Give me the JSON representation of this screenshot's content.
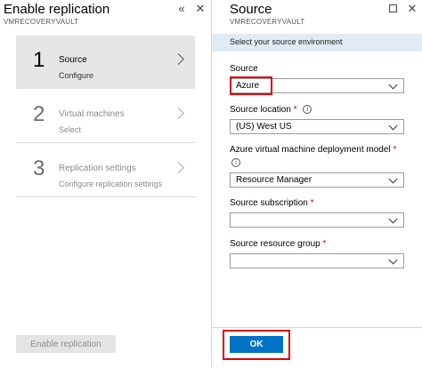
{
  "left_blade": {
    "title": "Enable replication",
    "subtitle": "VMRECOVERYVAULT",
    "icons": {
      "collapse": "double-chevron-left-icon",
      "close": "close-icon"
    },
    "steps": [
      {
        "number": "1",
        "title": "Source",
        "subtitle": "Configure",
        "state": "active"
      },
      {
        "number": "2",
        "title": "Virtual machines",
        "subtitle": "Select",
        "state": "inactive"
      },
      {
        "number": "3",
        "title": "Replication settings",
        "subtitle": "Configure replication settings",
        "state": "inactive"
      }
    ],
    "enable_button_label": "Enable replication"
  },
  "right_blade": {
    "title": "Source",
    "subtitle": "VMRECOVERYVAULT",
    "icons": {
      "maximize": "maximize-icon",
      "close": "close-icon"
    },
    "info_text": "Select your source environment",
    "fields": {
      "source": {
        "label": "Source",
        "value": "Azure"
      },
      "location": {
        "label": "Source location",
        "required": "*",
        "value": "(US) West US"
      },
      "deployment_model": {
        "label": "Azure virtual machine deployment model",
        "required": "*",
        "value": "Resource Manager"
      },
      "subscription": {
        "label": "Source subscription",
        "required": "*",
        "value": ""
      },
      "resource_group": {
        "label": "Source resource group",
        "required": "*",
        "value": ""
      }
    },
    "ok_label": "OK"
  },
  "colors": {
    "primary": "#0072c6",
    "info_bar": "#e2eaf6",
    "highlight": "#e00000",
    "active_step": "#e6e6e6"
  }
}
